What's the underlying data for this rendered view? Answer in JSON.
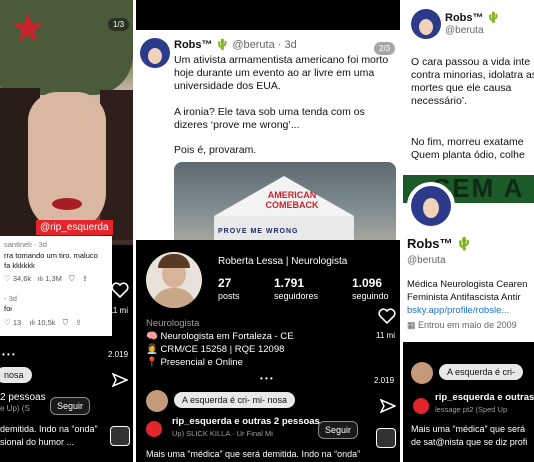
{
  "panel1": {
    "counter": "1/3",
    "overlay_handle": "@rip_esquerda",
    "comment1_user": "santinelı · 3d",
    "comment1_text": "rra tomando um tiro. maluco\nfa kkkkkk",
    "comment1_likes": "34,6k",
    "comment1_views": "1,3M",
    "comment2_user": "- 3d",
    "comment2_text": "foi",
    "comment2_likes": "13",
    "comment2_views": "10,5k",
    "like_count": "11 mi",
    "share_count": "2.019",
    "reply_pill": "nosa",
    "account": "2 pessoas",
    "music": "e Up) (S",
    "follow": "Seguir",
    "caption1": "demitida. Indo na “onda”",
    "caption2": "sional do humor ..."
  },
  "panel2": {
    "author_name": "Robs™",
    "author_handle": "@beruta · 3d",
    "counter": "2/3",
    "tweet_p1": "Um ativista armamentista americano foi morto hoje durante um evento ao ar livre em uma universidade dos EUA.",
    "tweet_p2": "A ironia? Ele tava sob uma tenda com os dizeres ‘prove me wrong’...",
    "tweet_p3": "Pois é, provaram.",
    "tent_banner": "AMERICAN COMEBACK",
    "tent_edge": "PROVE ME WRONG",
    "profile_name": "Roberta Lessa | Neurologista",
    "posts_count": "27",
    "posts_label": "posts",
    "followers_count": "1.791",
    "followers_label": "seguidores",
    "following_count": "1.096",
    "following_label": "seguindo",
    "category": "Neurologista",
    "bio1": "Neurologista em Fortaleza - CE",
    "bio2": "CRM/CE 15258 | RQE 12098",
    "bio3": "Presencial e Online",
    "reply_pill": "A esquerda é cri- mi- nosa",
    "account": "rip_esquerda e outras 2 pessoas",
    "music": "Up)  SLICK KILLA · Ur Final Mi",
    "follow": "Seguir",
    "caption": "Mais uma “médica” que será demitida. Indo na “onda”",
    "like_count": "11 mi",
    "share_count": "2.019"
  },
  "panel3": {
    "author_name": "Robs™",
    "author_handle": "@beruta",
    "tweet_p1": "O cara passou a vida inte contra minorias, idolatra as mortes que ele causa necessário’.",
    "tweet_p2": "No fim, morreu exatame Quem planta ódio, colhe",
    "banner_text": "SEM A",
    "profile_name": "Robs™",
    "profile_handle": "@beruta",
    "bio1": "Médica Neurologista Cearen",
    "bio2": "Feminista Antifascista Antir",
    "link": "bsky.app/profile/robsle...",
    "joined": "Entrou em maio de 2009",
    "reply_pill": "A esquerda é cri-",
    "account": "rip_esquerda e outras",
    "music": "lessage pt2 (Sped Up",
    "caption1": "Mais uma “médica” que será",
    "caption2": "de sat@nista que se diz profi"
  }
}
